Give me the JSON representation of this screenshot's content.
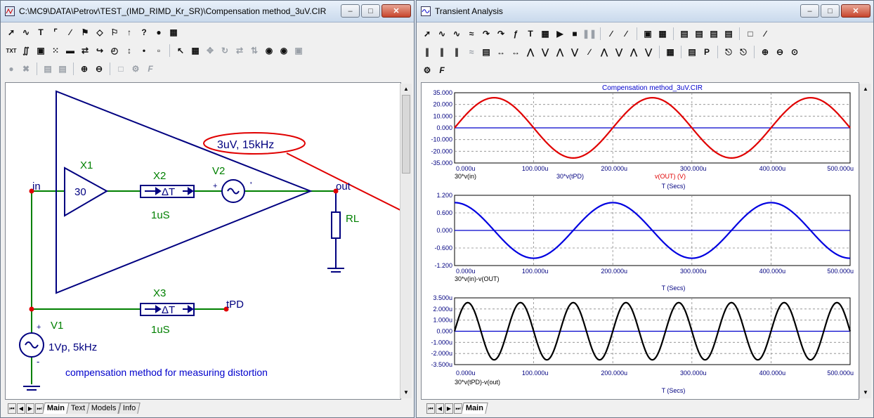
{
  "left_window": {
    "title": "C:\\MC9\\DATA\\Petrov\\TEST_(IMD_RIMD_Kr_SR)\\Compensation method_3uV.CIR",
    "tabs": [
      "Main",
      "Text",
      "Models",
      "Info"
    ],
    "active_tab": "Main"
  },
  "schematic": {
    "node_in": "in",
    "node_out": "out",
    "node_tpd": "tPD",
    "x1_name": "X1",
    "x1_gain": "30",
    "x2_name": "X2",
    "x2_value": "1uS",
    "x3_name": "X3",
    "x3_value": "1uS",
    "delay_symbol": "ΔT",
    "v2_name": "V2",
    "v2_plus": "+",
    "v2_minus": "'",
    "rl_name": "RL",
    "v1_name": "V1",
    "v1_value": "1Vp, 5kHz",
    "v1_plus": "+",
    "v1_minus": "-",
    "annotation": "3uV, 15kHz",
    "note": "compensation method for measuring distortion",
    "wire_color": "#008000",
    "component_color": "#000080",
    "node_color": "#e00000"
  },
  "right_window": {
    "title": "Transient Analysis",
    "tabs": [
      "Main"
    ],
    "active_tab": "Main"
  },
  "chart_data": [
    {
      "type": "line",
      "title": "Compensation method_3uV.CIR",
      "xlabel": "T (Secs)",
      "xlim": [
        0,
        500
      ],
      "ylim": [
        -35,
        35
      ],
      "xticks": [
        "0.000u",
        "100.000u",
        "200.000u",
        "300.000u",
        "400.000u",
        "500.000u"
      ],
      "yticks": [
        "35.000",
        "20.000",
        "10.000",
        "0.000",
        "-10.000",
        "-20.000",
        "-35.000"
      ],
      "legend_labels": [
        "30*v(in)",
        "30*v(tPD)",
        "v(OUT) (V)"
      ],
      "series": [
        {
          "name": "v(OUT) (V)",
          "color": "#e00000",
          "amplitude": 30,
          "frequency_khz": 5,
          "phase_deg": 0
        }
      ]
    },
    {
      "type": "line",
      "xlabel": "T (Secs)",
      "xlim": [
        0,
        500
      ],
      "ylim": [
        -1.2,
        1.2
      ],
      "xticks": [
        "0.000u",
        "100.000u",
        "200.000u",
        "300.000u",
        "400.000u",
        "500.000u"
      ],
      "yticks": [
        "1.200",
        "0.600",
        "0.000",
        "-0.600",
        "-1.200"
      ],
      "legend_labels": [
        "30*v(in)-v(OUT)"
      ],
      "series": [
        {
          "name": "30*v(in)-v(OUT)",
          "color": "#0000e0",
          "amplitude": 0.95,
          "frequency_khz": 5,
          "phase_deg": 90
        }
      ]
    },
    {
      "type": "line",
      "xlabel": "T (Secs)",
      "xlim": [
        0,
        500
      ],
      "ylim": [
        -3.5,
        3.5
      ],
      "xticks": [
        "0.000u",
        "100.000u",
        "200.000u",
        "300.000u",
        "400.000u",
        "500.000u"
      ],
      "yticks": [
        "3.500u",
        "2.000u",
        "1.000u",
        "0.000",
        "-1.000u",
        "-2.000u",
        "-3.500u"
      ],
      "legend_labels": [
        "30*v(tPD)-v(out)"
      ],
      "series": [
        {
          "name": "30*v(tPD)-v(out)",
          "color": "#000000",
          "amplitude": 3,
          "frequency_khz": 15,
          "phase_deg": 0
        }
      ]
    }
  ]
}
